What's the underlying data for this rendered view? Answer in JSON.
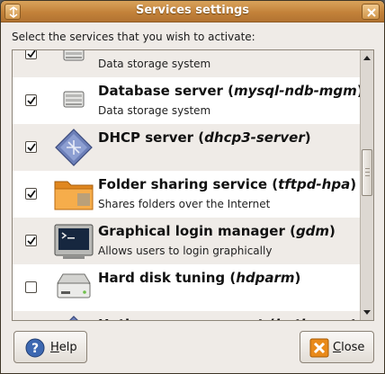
{
  "window": {
    "title": "Services settings"
  },
  "prompt": "Select the services that you wish to activate:",
  "services": [
    {
      "name": "",
      "daemon": "",
      "description": "Data storage system",
      "checked": true,
      "icon": "drive-icon"
    },
    {
      "name": "Database server",
      "daemon": "mysql-ndb-mgm",
      "description": "Data storage system",
      "checked": true,
      "icon": "drive-icon"
    },
    {
      "name": "DHCP server",
      "daemon": "dhcp3-server",
      "description": "",
      "checked": true,
      "icon": "network-diamond-icon"
    },
    {
      "name": "Folder sharing service",
      "daemon": "tftpd-hpa",
      "description": "Shares folders over the Internet",
      "checked": true,
      "icon": "folder-icon"
    },
    {
      "name": "Graphical login manager",
      "daemon": "gdm",
      "description": "Allows users to login graphically",
      "checked": true,
      "icon": "terminal-icon"
    },
    {
      "name": "Hard disk tuning",
      "daemon": "hdparm",
      "description": "",
      "checked": false,
      "icon": "harddisk-icon"
    },
    {
      "name": "Hotkeys management",
      "daemon": "hotkey-setup",
      "description": "",
      "checked": true,
      "icon": "network-diamond-icon"
    }
  ],
  "buttons": {
    "help": {
      "mnemonic": "H",
      "rest": "elp"
    },
    "close": {
      "mnemonic": "C",
      "rest": "lose"
    }
  },
  "colors": {
    "titlebar": "#c3823a",
    "window_bg": "#efebe7",
    "diamond": "#6c7fb8",
    "folder": "#f3a23a"
  }
}
